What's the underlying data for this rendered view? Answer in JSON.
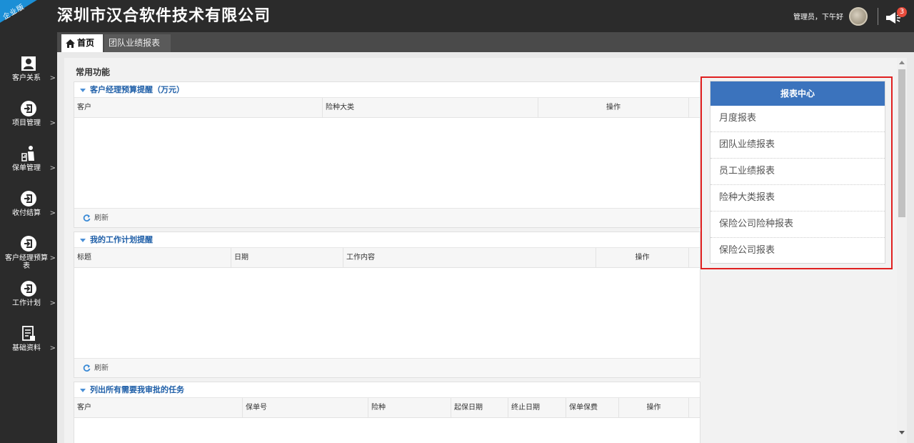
{
  "header": {
    "corner_label": "企业版",
    "company": "深圳市汉合软件技术有限公司",
    "greeting": "管理员，下午好",
    "notification_count": "3"
  },
  "sidebar": {
    "items": [
      {
        "label": "客户关系",
        "icon": "user-icon"
      },
      {
        "label": "项目管理",
        "icon": "enter-icon"
      },
      {
        "label": "保单管理",
        "icon": "person-chart-icon"
      },
      {
        "label": "收付结算",
        "icon": "enter-icon"
      },
      {
        "label": "客户经理预算表",
        "icon": "enter-icon"
      },
      {
        "label": "工作计划",
        "icon": "enter-icon"
      },
      {
        "label": "基础资料",
        "icon": "document-icon"
      }
    ],
    "arrow": ">"
  },
  "tabs": {
    "home": "首页",
    "report": "团队业绩报表",
    "close": "×"
  },
  "main": {
    "section_title": "常用功能",
    "budget": {
      "title": "客户经理预算提醒（万元）",
      "columns": [
        "客户",
        "险种大类",
        "操作"
      ],
      "refresh": "刷新"
    },
    "plan": {
      "title": "我的工作计划提醒",
      "columns": [
        "标题",
        "日期",
        "工作内容",
        "操作"
      ],
      "refresh": "刷新"
    },
    "tasks": {
      "title": "列出所有需要我审批的任务",
      "columns": [
        "客户",
        "保单号",
        "险种",
        "起保日期",
        "终止日期",
        "保单保费",
        "操作"
      ]
    }
  },
  "report_center": {
    "title": "报表中心",
    "items": [
      "月度报表",
      "团队业绩报表",
      "员工业绩报表",
      "险种大类报表",
      "保险公司险种报表",
      "保险公司报表"
    ]
  },
  "colors": {
    "dark_bg": "#2b2b2b",
    "accent_blue": "#3b73bd",
    "highlight_red": "#e02020",
    "badge_red": "#e74c3c"
  }
}
